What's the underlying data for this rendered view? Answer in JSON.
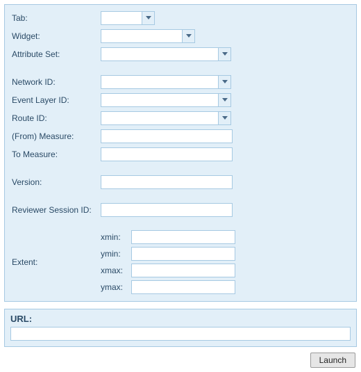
{
  "labels": {
    "tab": "Tab:",
    "widget": "Widget:",
    "attributeSet": "Attribute Set:",
    "networkId": "Network ID:",
    "eventLayerId": "Event Layer ID:",
    "routeId": "Route ID:",
    "fromMeasure": "(From) Measure:",
    "toMeasure": "To Measure:",
    "version": "Version:",
    "reviewerSession": "Reviewer Session ID:",
    "extent": "Extent:",
    "xmin": "xmin:",
    "ymin": "ymin:",
    "xmax": "xmax:",
    "ymax": "ymax:",
    "url": "URL:"
  },
  "values": {
    "tab": "",
    "widget": "",
    "attributeSet": "",
    "networkId": "",
    "eventLayerId": "",
    "routeId": "",
    "fromMeasure": "",
    "toMeasure": "",
    "version": "",
    "reviewerSession": "",
    "xmin": "",
    "ymin": "",
    "xmax": "",
    "ymax": "",
    "url": ""
  },
  "buttons": {
    "launch": "Launch"
  }
}
